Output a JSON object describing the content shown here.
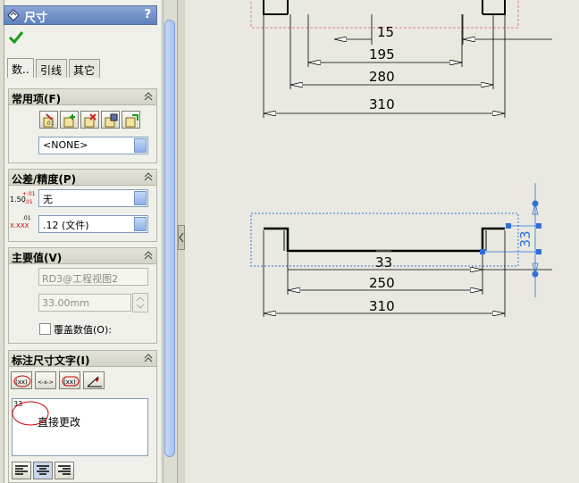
{
  "panel": {
    "title": "尺寸",
    "help": "?",
    "tabs": [
      "数..",
      "引线",
      "其它"
    ],
    "favorites": {
      "header": "常用项(F)",
      "dropdown_value": "<NONE>",
      "icons": [
        "apply-favorite-icon",
        "add-favorite-icon",
        "delete-favorite-icon",
        "save-favorite-icon",
        "load-favorite-icon"
      ]
    },
    "tolerance": {
      "header": "公差/精度(P)",
      "tol_icon_value": "1.50",
      "tol_icon_plus": "+.01",
      "tol_icon_minus": "-.01",
      "prec_icon_value": "X.XXX",
      "prec_icon_sup": ".01",
      "tolerance_value": "无",
      "precision_value": ".12 (文件)"
    },
    "primary_value": {
      "header": "主要值(V)",
      "reference": "RD3@工程视图2",
      "value": "33.00mm",
      "override_label": "覆盖数值(O):"
    },
    "dimension_text": {
      "header": "标注尺寸文字(I)",
      "format_buttons": [
        "(xx)",
        "<-x->",
        "(xx)",
        "angle"
      ],
      "text_line1": "33",
      "text_line2": "直接更改",
      "align_buttons": [
        "align-left",
        "align-center",
        "align-right"
      ]
    }
  },
  "drawing": {
    "upper_view_dims": [
      "15",
      "195",
      "280",
      "310"
    ],
    "lower_view_dims": [
      "33",
      "250",
      "310"
    ],
    "selected_dim": "33"
  },
  "colors": {
    "title_bar": "#6f8fc9",
    "selection": "#2f6fd6",
    "dim_line": "#000000",
    "annotation_circle": "#d00000"
  }
}
